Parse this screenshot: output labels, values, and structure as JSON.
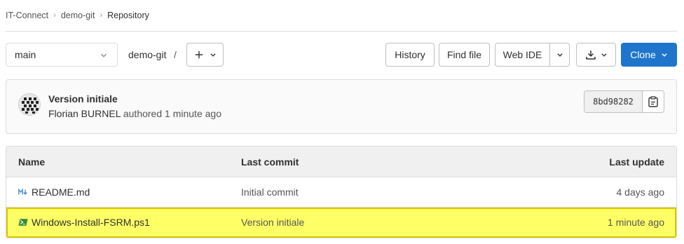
{
  "breadcrumb": {
    "items": [
      "IT-Connect",
      "demo-git",
      "Repository"
    ]
  },
  "toolbar": {
    "branch": "main",
    "path": "demo-git",
    "path_sep": "/",
    "history_label": "History",
    "find_file_label": "Find file",
    "web_ide_label": "Web IDE",
    "clone_label": "Clone",
    "accent_color": "#1f75cb"
  },
  "commit": {
    "title": "Version initiale",
    "author": "Florian BURNEL",
    "action": "authored",
    "time": "1 minute ago",
    "sha": "8bd98282"
  },
  "table": {
    "headers": [
      "Name",
      "Last commit",
      "Last update"
    ],
    "rows": [
      {
        "icon": "markdown-icon",
        "name": "README.md",
        "commit": "Initial commit",
        "date": "4 days ago",
        "highlighted": false
      },
      {
        "icon": "powershell-icon",
        "name": "Windows-Install-FSRM.ps1",
        "commit": "Version initiale",
        "date": "1 minute ago",
        "highlighted": true
      }
    ],
    "highlight_color": "#ffff66"
  }
}
